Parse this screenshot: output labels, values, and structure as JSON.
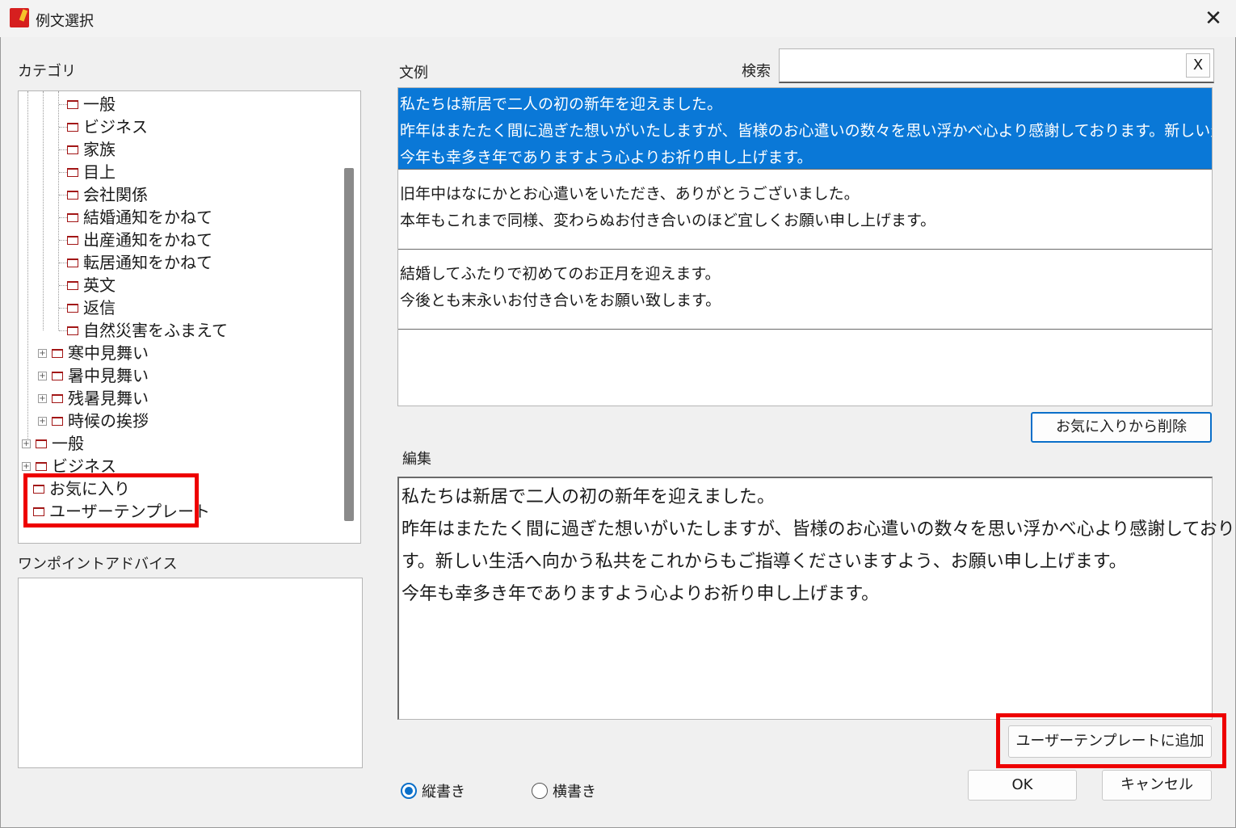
{
  "window": {
    "title": "例文選択",
    "close_glyph": "✕"
  },
  "category": {
    "label": "カテゴリ",
    "sub_items": [
      "一般",
      "ビジネス",
      "家族",
      "目上",
      "会社関係",
      "結婚通知をかねて",
      "出産通知をかねて",
      "転居通知をかねて",
      "英文",
      "返信",
      "自然災害をふまえて"
    ],
    "mid_items": [
      "寒中見舞い",
      "暑中見舞い",
      "残暑見舞い",
      "時候の挨拶"
    ],
    "top_items": [
      "一般",
      "ビジネス"
    ],
    "favorites": "お気に入り",
    "user_templates": "ユーザーテンプレート",
    "expander_glyph": "+"
  },
  "advice": {
    "label": "ワンポイントアドバイス"
  },
  "examples": {
    "label": "文例",
    "search_label": "検索",
    "search_value": "",
    "clear_label": "X",
    "items": [
      {
        "selected": true,
        "lines": [
          "私たちは新居で二人の初の新年を迎えました。",
          "昨年はまたたく間に過ぎた想いがいたしますが、皆様のお心遣いの数々を思い浮かべ心より感謝しております。新しい生活へ",
          "今年も幸多き年でありますよう心よりお祈り申し上げます。"
        ]
      },
      {
        "selected": false,
        "lines": [
          "旧年中はなにかとお心遣いをいただき、ありがとうございました。",
          "本年もこれまで同様、変わらぬお付き合いのほど宜しくお願い申し上げます。"
        ]
      },
      {
        "selected": false,
        "lines": [
          "結婚してふたりで初めてのお正月を迎えます。",
          "今後とも末永いお付き合いをお願い致します。"
        ]
      }
    ],
    "remove_favorite_label": "お気に入りから削除"
  },
  "edit": {
    "label": "編集",
    "lines": [
      "私たちは新居で二人の初の新年を迎えました。",
      "昨年はまたたく間に過ぎた想いがいたしますが、皆様のお心遣いの数々を思い浮かべ心より感謝しておりま",
      "す。新しい生活へ向かう私共をこれからもご指導くださいますよう、お願い申し上げます。",
      "今年も幸多き年でありますよう心よりお祈り申し上げます。"
    ],
    "add_template_label": "ユーザーテンプレートに追加"
  },
  "orientation": {
    "vertical_label": "縦書き",
    "horizontal_label": "横書き",
    "selected": "vertical"
  },
  "buttons": {
    "ok": "OK",
    "cancel": "キャンセル"
  },
  "colors": {
    "highlight": "#0a78d7",
    "annotation_red": "#ee0000",
    "folder_red": "#a21616"
  }
}
